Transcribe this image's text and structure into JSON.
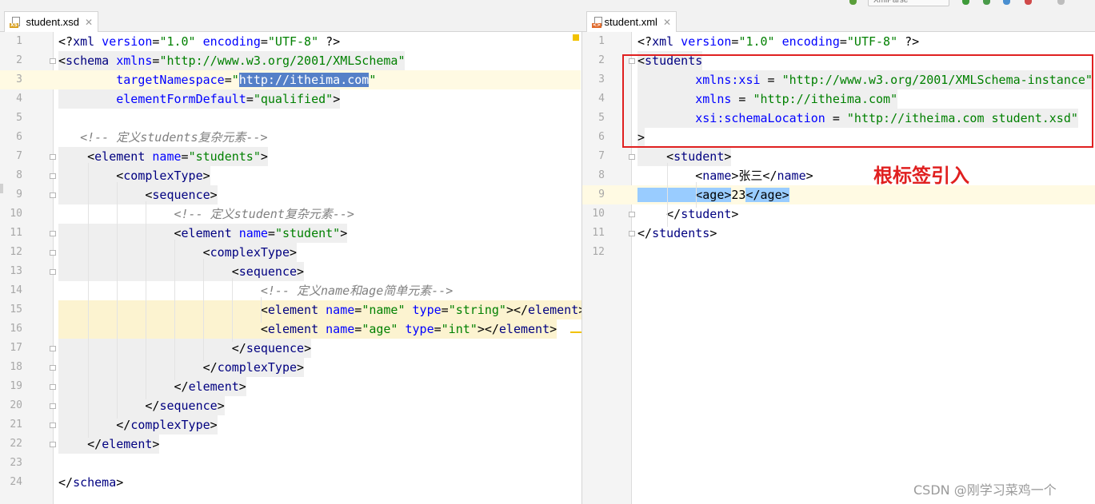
{
  "topbar": {
    "run_config": "XmlParse"
  },
  "tabs": {
    "left": {
      "name": "student.xsd",
      "badge": "XS",
      "badge_color": "#d8a020"
    },
    "right": {
      "name": "student.xml",
      "badge": "<>",
      "badge_color": "#e06a2c"
    }
  },
  "editor_left": {
    "line_numbers": [
      "1",
      "2",
      "3",
      "4",
      "5",
      "6",
      "7",
      "8",
      "9",
      "10",
      "11",
      "12",
      "13",
      "14",
      "15",
      "16",
      "17",
      "18",
      "19",
      "20",
      "21",
      "22",
      "23",
      "24"
    ],
    "lines": [
      [
        {
          "c": "p",
          "t": "<?"
        },
        {
          "c": "t",
          "t": "xml"
        },
        {
          "c": "a",
          "t": " version"
        },
        {
          "c": "p",
          "t": "="
        },
        {
          "c": "v",
          "t": "\"1.0\""
        },
        {
          "c": "a",
          "t": " encoding"
        },
        {
          "c": "p",
          "t": "="
        },
        {
          "c": "v",
          "t": "\"UTF-8\""
        },
        {
          "c": "p",
          "t": " ?>"
        }
      ],
      [
        {
          "c": "p",
          "t": "<"
        },
        {
          "c": "t",
          "t": "schema"
        },
        {
          "c": "a",
          "t": " xmlns"
        },
        {
          "c": "p",
          "t": "="
        },
        {
          "c": "v",
          "t": "\"http://www.w3.org/2001/XMLSchema\""
        }
      ],
      [
        {
          "c": "a",
          "t": "        targetNamespace"
        },
        {
          "c": "p",
          "t": "="
        },
        {
          "c": "v",
          "t": "\""
        },
        {
          "c": "sel",
          "t": "http://itheima.com"
        },
        {
          "c": "v",
          "t": "\""
        }
      ],
      [
        {
          "c": "a",
          "t": "        elementFormDefault"
        },
        {
          "c": "p",
          "t": "="
        },
        {
          "c": "v",
          "t": "\"qualified\""
        },
        {
          "c": "p",
          "t": ">"
        }
      ],
      [],
      [
        {
          "c": "k",
          "t": "   <!-- 定义students复杂元素-->"
        }
      ],
      [
        {
          "c": "p",
          "t": "    <"
        },
        {
          "c": "t",
          "t": "element"
        },
        {
          "c": "a",
          "t": " name"
        },
        {
          "c": "p",
          "t": "="
        },
        {
          "c": "v",
          "t": "\"students\""
        },
        {
          "c": "p",
          "t": ">"
        }
      ],
      [
        {
          "c": "p",
          "t": "        <"
        },
        {
          "c": "t",
          "t": "complexType"
        },
        {
          "c": "p",
          "t": ">"
        }
      ],
      [
        {
          "c": "p",
          "t": "            <"
        },
        {
          "c": "t",
          "t": "sequence"
        },
        {
          "c": "p",
          "t": ">"
        }
      ],
      [
        {
          "c": "k",
          "t": "                <!-- 定义student复杂元素-->"
        }
      ],
      [
        {
          "c": "p",
          "t": "                <"
        },
        {
          "c": "t",
          "t": "element"
        },
        {
          "c": "a",
          "t": " name"
        },
        {
          "c": "p",
          "t": "="
        },
        {
          "c": "v",
          "t": "\"student\""
        },
        {
          "c": "p",
          "t": ">"
        }
      ],
      [
        {
          "c": "p",
          "t": "                    <"
        },
        {
          "c": "t",
          "t": "complexType"
        },
        {
          "c": "p",
          "t": ">"
        }
      ],
      [
        {
          "c": "p",
          "t": "                        <"
        },
        {
          "c": "t",
          "t": "sequence"
        },
        {
          "c": "p",
          "t": ">"
        }
      ],
      [
        {
          "c": "k",
          "t": "                            <!-- 定义name和age简单元素-->"
        }
      ],
      [
        {
          "c": "p",
          "t": "                            <"
        },
        {
          "c": "t",
          "t": "element"
        },
        {
          "c": "a",
          "t": " name"
        },
        {
          "c": "p",
          "t": "="
        },
        {
          "c": "v",
          "t": "\"name\""
        },
        {
          "c": "a",
          "t": " type"
        },
        {
          "c": "p",
          "t": "="
        },
        {
          "c": "v",
          "t": "\"string\""
        },
        {
          "c": "p",
          "t": "></"
        },
        {
          "c": "t",
          "t": "element"
        },
        {
          "c": "p",
          "t": ">"
        }
      ],
      [
        {
          "c": "p",
          "t": "                            <"
        },
        {
          "c": "t",
          "t": "element"
        },
        {
          "c": "a",
          "t": " name"
        },
        {
          "c": "p",
          "t": "="
        },
        {
          "c": "v",
          "t": "\"age\""
        },
        {
          "c": "a",
          "t": " type"
        },
        {
          "c": "p",
          "t": "="
        },
        {
          "c": "v",
          "t": "\"int\""
        },
        {
          "c": "p",
          "t": "></"
        },
        {
          "c": "t",
          "t": "element"
        },
        {
          "c": "p",
          "t": ">"
        }
      ],
      [
        {
          "c": "p",
          "t": "                        </"
        },
        {
          "c": "t",
          "t": "sequence"
        },
        {
          "c": "p",
          "t": ">"
        }
      ],
      [
        {
          "c": "p",
          "t": "                    </"
        },
        {
          "c": "t",
          "t": "complexType"
        },
        {
          "c": "p",
          "t": ">"
        }
      ],
      [
        {
          "c": "p",
          "t": "                </"
        },
        {
          "c": "t",
          "t": "element"
        },
        {
          "c": "p",
          "t": ">"
        }
      ],
      [
        {
          "c": "p",
          "t": "            </"
        },
        {
          "c": "t",
          "t": "sequence"
        },
        {
          "c": "p",
          "t": ">"
        }
      ],
      [
        {
          "c": "p",
          "t": "        </"
        },
        {
          "c": "t",
          "t": "complexType"
        },
        {
          "c": "p",
          "t": ">"
        }
      ],
      [
        {
          "c": "p",
          "t": "    </"
        },
        {
          "c": "t",
          "t": "element"
        },
        {
          "c": "p",
          "t": ">"
        }
      ],
      [],
      [
        {
          "c": "p",
          "t": "</"
        },
        {
          "c": "t",
          "t": "schema"
        },
        {
          "c": "p",
          "t": ">"
        }
      ]
    ]
  },
  "editor_right": {
    "line_numbers": [
      "1",
      "2",
      "3",
      "4",
      "5",
      "6",
      "7",
      "8",
      "9",
      "10",
      "11",
      "12"
    ],
    "lines": [
      [
        {
          "c": "p",
          "t": "<?"
        },
        {
          "c": "t",
          "t": "xml"
        },
        {
          "c": "a",
          "t": " version"
        },
        {
          "c": "p",
          "t": "="
        },
        {
          "c": "v",
          "t": "\"1.0\""
        },
        {
          "c": "a",
          "t": " encoding"
        },
        {
          "c": "p",
          "t": "="
        },
        {
          "c": "v",
          "t": "\"UTF-8\""
        },
        {
          "c": "p",
          "t": " ?>"
        }
      ],
      [
        {
          "c": "p",
          "t": "<"
        },
        {
          "c": "t",
          "t": "students"
        }
      ],
      [
        {
          "c": "a",
          "t": "        xmlns:xsi"
        },
        {
          "c": "p",
          "t": " = "
        },
        {
          "c": "v",
          "t": "\"http://www.w3.org/2001/XMLSchema-instance\""
        }
      ],
      [
        {
          "c": "a",
          "t": "        xmlns"
        },
        {
          "c": "p",
          "t": " = "
        },
        {
          "c": "v",
          "t": "\"http://itheima.com\""
        }
      ],
      [
        {
          "c": "a",
          "t": "        xsi:schemaLocation"
        },
        {
          "c": "p",
          "t": " = "
        },
        {
          "c": "v",
          "t": "\"http://itheima.com student.xsd\""
        }
      ],
      [
        {
          "c": "p",
          "t": ">"
        }
      ],
      [
        {
          "c": "p",
          "t": "    <"
        },
        {
          "c": "t",
          "t": "student"
        },
        {
          "c": "p",
          "t": ">"
        }
      ],
      [
        {
          "c": "p",
          "t": "        <"
        },
        {
          "c": "t",
          "t": "name"
        },
        {
          "c": "p",
          "t": ">张三</"
        },
        {
          "c": "t",
          "t": "name"
        },
        {
          "c": "p",
          "t": ">"
        }
      ],
      [
        {
          "c": "tagbg",
          "t": "        <age>"
        },
        {
          "c": "p",
          "t": "23"
        },
        {
          "c": "tagbg",
          "t": "</age>"
        }
      ],
      [
        {
          "c": "p",
          "t": "    </"
        },
        {
          "c": "t",
          "t": "student"
        },
        {
          "c": "p",
          "t": ">"
        }
      ],
      [
        {
          "c": "p",
          "t": "</"
        },
        {
          "c": "t",
          "t": "students"
        },
        {
          "c": "p",
          "t": ">"
        }
      ],
      []
    ]
  },
  "annotation": "根标签引入",
  "watermark": "CSDN @刚学习菜鸡一个",
  "colors": {
    "tag": "#000080",
    "attribute": "#0000ff",
    "value": "#008000",
    "comment": "#808080",
    "current_line": "#fffae3",
    "tag_bg": "#efefef",
    "match_highlight": "#fcf3d0",
    "selection": "#5580c8",
    "annotation_red": "#e02020"
  }
}
